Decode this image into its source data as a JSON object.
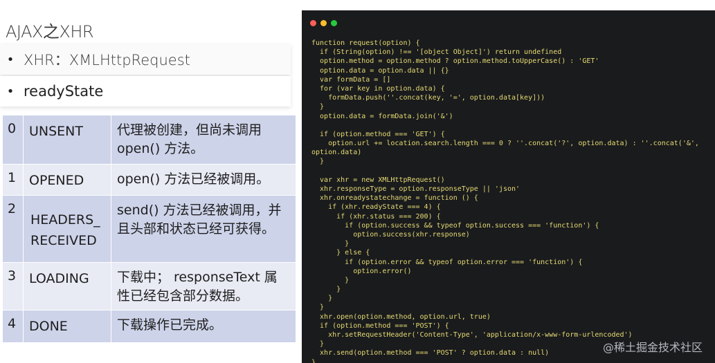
{
  "slide": {
    "title": "AJAX之XHR",
    "bullets": [
      {
        "dot": "•",
        "text": "XHR：XMLHttpRequest"
      },
      {
        "dot": "•",
        "text": "readyState"
      }
    ],
    "states": [
      {
        "num": "0",
        "name": "UNSENT",
        "desc": "代理被创建，但尚未调用 open() 方法。"
      },
      {
        "num": "1",
        "name": "OPENED",
        "desc": "open() 方法已经被调用。"
      },
      {
        "num": "2",
        "name": "HEADERS_RECEIVED",
        "desc": "send() 方法已经被调用，并且头部和状态已经可获得。"
      },
      {
        "num": "3",
        "name": "LOADING",
        "desc": "下载中； responseText 属性已经包含部分数据。"
      },
      {
        "num": "4",
        "name": "DONE",
        "desc": "下载操作已完成。"
      }
    ]
  },
  "code_window": {
    "dots": {
      "close": "#ff5f56",
      "minimize": "#ffbd2e",
      "maximize": "#27c93f"
    },
    "lines": [
      "function request(option) {",
      "  if (String(option) !== '[object Object]') return undefined",
      "  option.method = option.method ? option.method.toUpperCase() : 'GET'",
      "  option.data = option.data || {}",
      "  var formData = []",
      "  for (var key in option.data) {",
      "    formData.push(''.concat(key, '=', option.data[key]))",
      "  }",
      "  option.data = formData.join('&')",
      "",
      "  if (option.method === 'GET') {",
      "    option.url += location.search.length === 0 ? ''.concat('?', option.data) : ''.concat('&',",
      "option.data)",
      "  }",
      "",
      "  var xhr = new XMLHttpRequest()",
      "  xhr.responseType = option.responseType || 'json'",
      "  xhr.onreadystatechange = function () {",
      "    if (xhr.readyState === 4) {",
      "      if (xhr.status === 200) {",
      "        if (option.success && typeof option.success === 'function') {",
      "          option.success(xhr.response)",
      "        }",
      "      } else {",
      "        if (option.error && typeof option.error === 'function') {",
      "          option.error()",
      "        }",
      "      }",
      "    }",
      "  }",
      "  xhr.open(option.method, option.url, true)",
      "  if (option.method === 'POST') {",
      "    xhr.setRequestHeader('Content-Type', 'application/x-www-form-urlencoded')",
      "  }",
      "  xhr.send(option.method === 'POST' ? option.data : null)",
      "}"
    ],
    "watermark": "@稀土掘金技术社区"
  }
}
